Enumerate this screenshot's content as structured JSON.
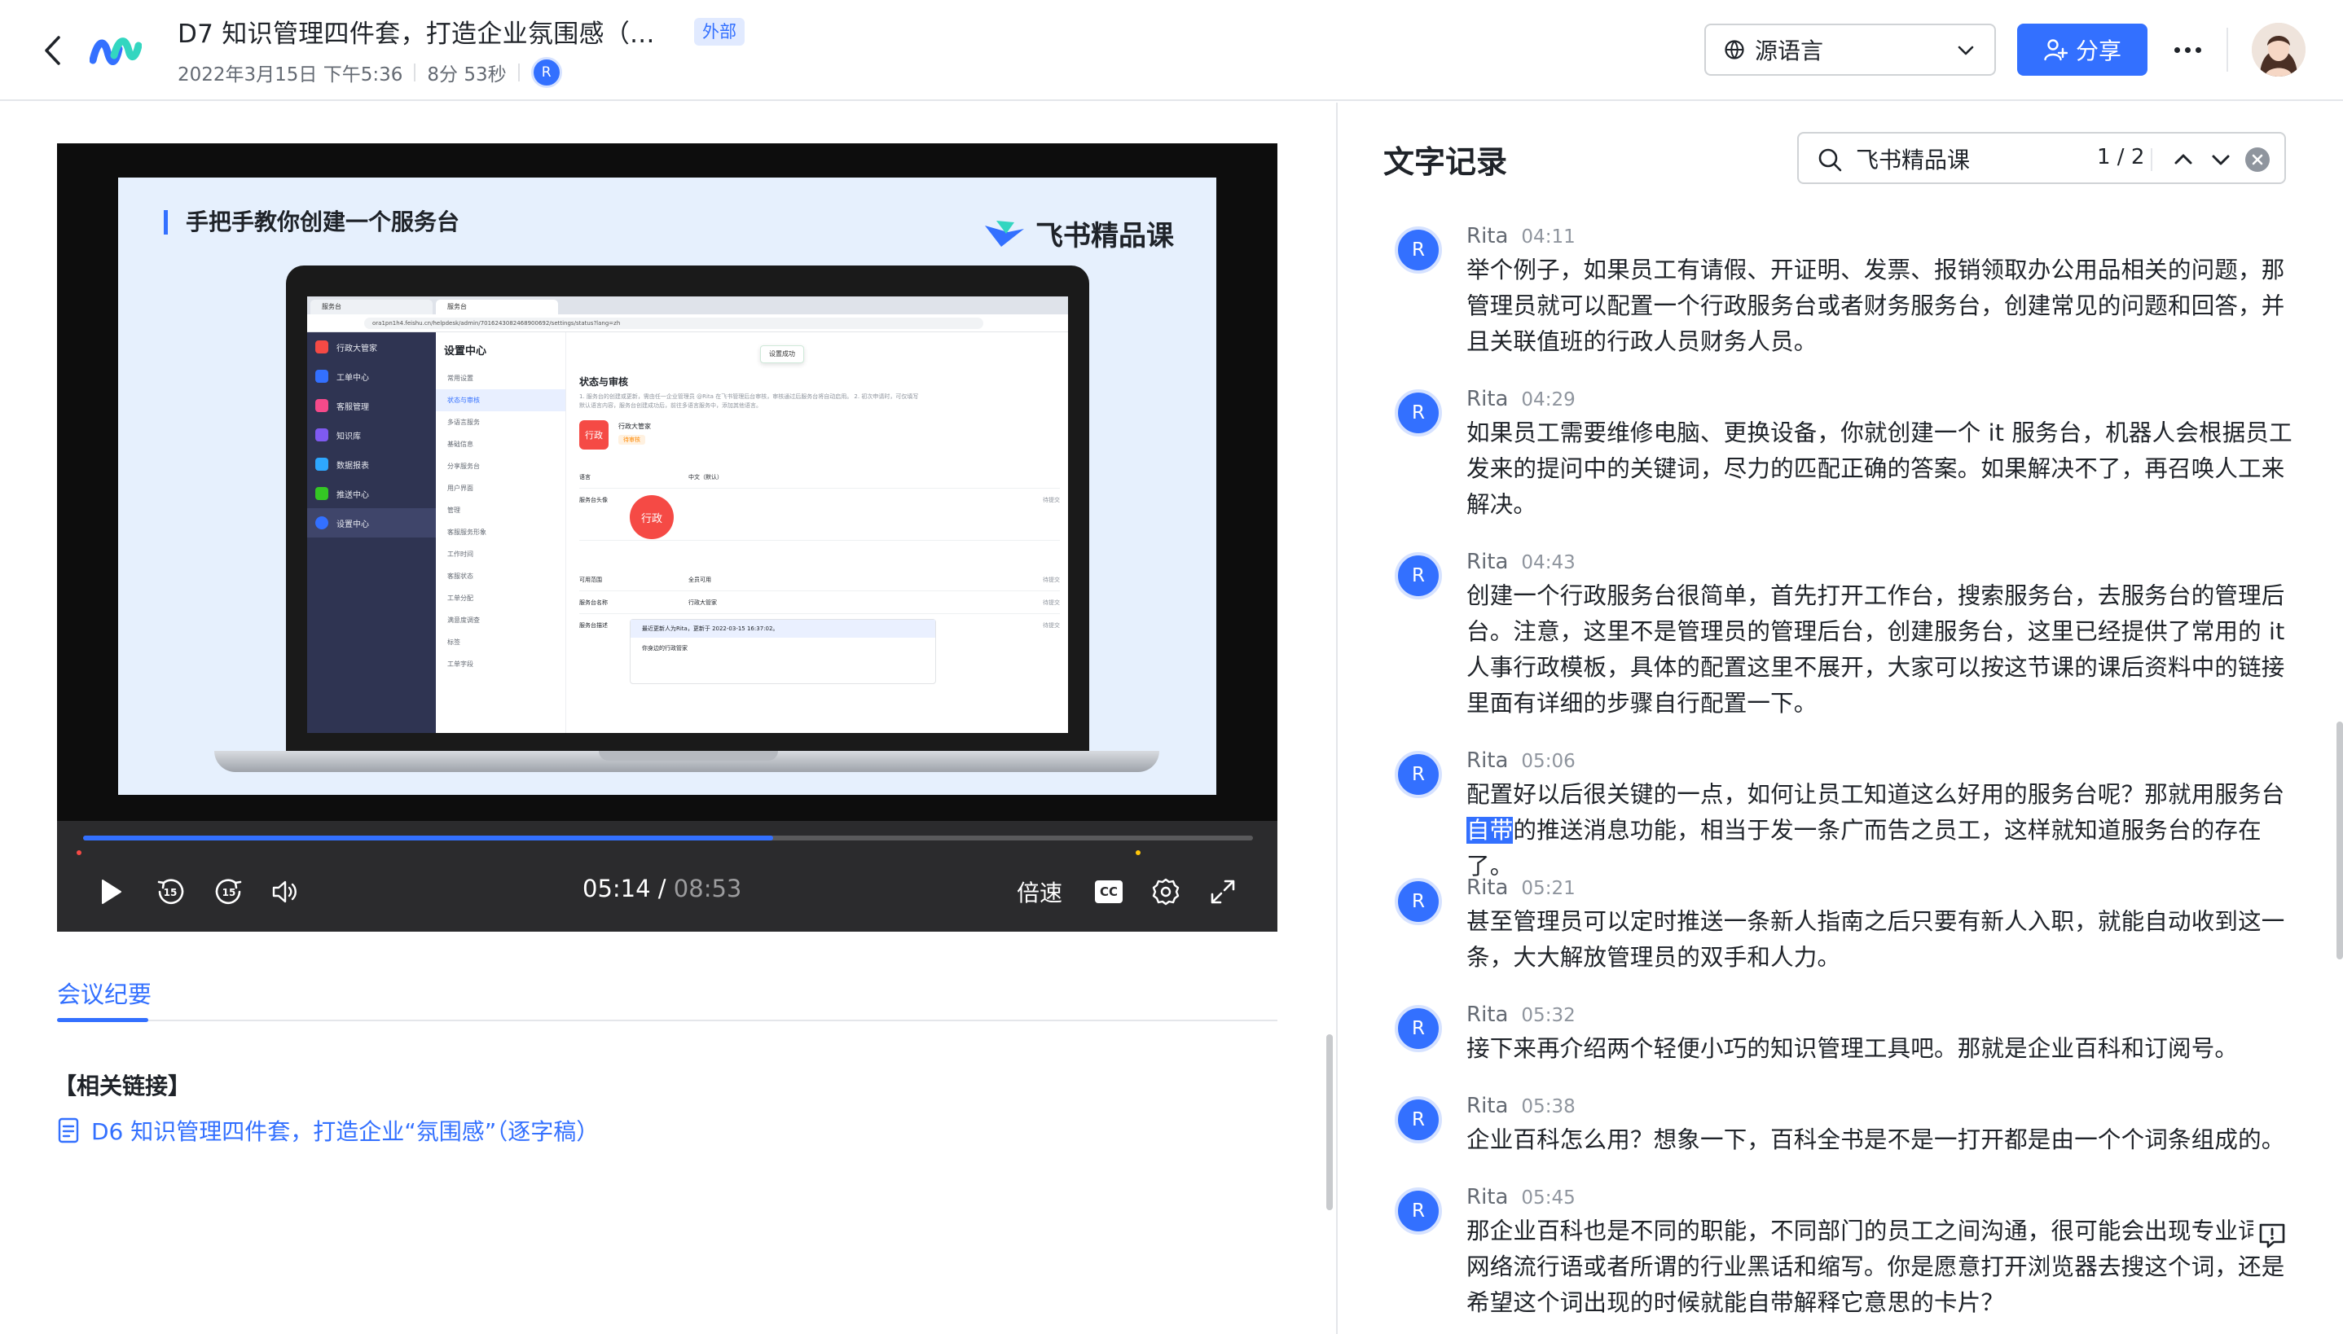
{
  "header": {
    "title": "D7 知识管理四件套，打造企业氛围感（...",
    "badge": "外部",
    "date": "2022年3月15日 下午5:36",
    "duration": "8分 53秒",
    "participant_initial": "R",
    "language_select": "源语言",
    "share_label": "分享",
    "icons": [
      "back-arrow-icon",
      "app-logo-icon",
      "globe-icon",
      "chevron-down-icon",
      "add-user-icon",
      "more-icon"
    ]
  },
  "video": {
    "slide_title": "手把手教你创建一个服务台",
    "course_brand": "飞书精品课",
    "screen": {
      "tab1": "服务台",
      "tab2": "服务台",
      "url": "ora1pn1h4.feishu.cn/helpdesk/admin/7016243082468900692/settings/status?lang=zh",
      "sidebar_app": "行政大管家",
      "sidebar_items": [
        "工单中心",
        "客服管理",
        "知识库",
        "数据报表",
        "推送中心",
        "设置中心"
      ],
      "nav_title": "设置中心",
      "nav_items": [
        "常用设置",
        "状态与审核",
        "多语言服务",
        "基础信息",
        "分享服务台",
        "用户界面",
        "管理",
        "客服服务形象",
        "工作时间",
        "客服状态",
        "工单分配",
        "满意度调查",
        "标签",
        "工单字段"
      ],
      "toast": "设置成功",
      "section_title": "状态与审核",
      "section_desc": "1. 服务台的创建或更新，需由任一企业管理员 @Rita 在飞书管理后台审核，审核通过后服务台将自动启用。 2. 初次申请时，可仅填写默认语言内容，服务台创建成功后，前往多语言服务中，添加其他语言。",
      "app_icon_text": "行政",
      "app_name": "行政大管家",
      "app_status": "待审核",
      "rows": [
        {
          "label": "语言",
          "value": "中文（默认）",
          "status": ""
        },
        {
          "label": "服务台头像",
          "value": "",
          "status": "待提交"
        },
        {
          "label": "可用范围",
          "value": "全员可用",
          "status": "待提交"
        },
        {
          "label": "服务台名称",
          "value": "行政大管家",
          "status": "待提交"
        },
        {
          "label": "服务台描述",
          "value": "",
          "status": "待提交"
        }
      ],
      "notice": "最近更新人为Rita，更新于 2022-03-15 16:37:02。",
      "desc_value": "你身边的行政管家"
    },
    "current_time": "05:14",
    "time_separator": "/",
    "total_time": "08:53",
    "progress": 0.59,
    "speed_label": "倍速",
    "cc_label": "CC",
    "skip_back_label": "15",
    "skip_fwd_label": "15"
  },
  "left": {
    "tab_minutes": "会议纪要",
    "links_heading": "【相关链接】",
    "doc_link": "D6 知识管理四件套，打造企业“氛围感”（逐字稿）"
  },
  "transcript": {
    "title": "文字记录",
    "search_value": "飞书精品课",
    "search_count": "1 / 2",
    "entries": [
      {
        "speaker": "Rita",
        "initial": "R",
        "time": "04:11",
        "text": "举个例子，如果员工有请假、开证明、发票、报销领取办公用品相关的问题，那管理员就可以配置一个行政服务台或者财务服务台，创建常见的问题和回答，并且关联值班的行政人员财务人员。"
      },
      {
        "speaker": "Rita",
        "initial": "R",
        "time": "04:29",
        "text": "如果员工需要维修电脑、更换设备，你就创建一个 it 服务台，机器人会根据员工发来的提问中的关键词，尽力的匹配正确的答案。如果解决不了，再召唤人工来解决。"
      },
      {
        "speaker": "Rita",
        "initial": "R",
        "time": "04:43",
        "text": "创建一个行政服务台很简单，首先打开工作台，搜索服务台，去服务台的管理后台。注意，这里不是管理员的管理后台，创建服务台，这里已经提供了常用的 it 人事行政模板，具体的配置这里不展开，大家可以按这节课的课后资料中的链接里面有详细的步骤自行配置一下。"
      },
      {
        "speaker": "Rita",
        "initial": "R",
        "time": "05:06",
        "text_before": "配置好以后很关键的一点，如何让员工知道这么好用的服务台呢？那就用服务台",
        "text_highlight": "自带",
        "text_after": "的推送消息功能，相当于发一条广而告之员工，这样就知道服务台的存在了。"
      },
      {
        "speaker": "Rita",
        "initial": "R",
        "time": "05:21",
        "text": "甚至管理员可以定时推送一条新人指南之后只要有新人入职，就能自动收到这一条，大大解放管理员的双手和人力。"
      },
      {
        "speaker": "Rita",
        "initial": "R",
        "time": "05:32",
        "text": "接下来再介绍两个轻便小巧的知识管理工具吧。那就是企业百科和订阅号。"
      },
      {
        "speaker": "Rita",
        "initial": "R",
        "time": "05:38",
        "text": "企业百科怎么用？想象一下，百科全书是不是一打开都是由一个个词条组成的。"
      },
      {
        "speaker": "Rita",
        "initial": "R",
        "time": "05:45",
        "text": "那企业百科也是不同的职能，不同部门的员工之间沟通，很可能会出现专业词汇网络流行语或者所谓的行业黑话和缩写。你是愿意打开浏览器去搜这个词，还是希望这个词出现的时候就能自带解释它意思的卡片？"
      }
    ]
  },
  "colors": {
    "accent": "#3370ff",
    "text": "#1f2329",
    "muted": "#646a73",
    "badge_bg": "#e1eaff",
    "red": "#f54a45"
  }
}
